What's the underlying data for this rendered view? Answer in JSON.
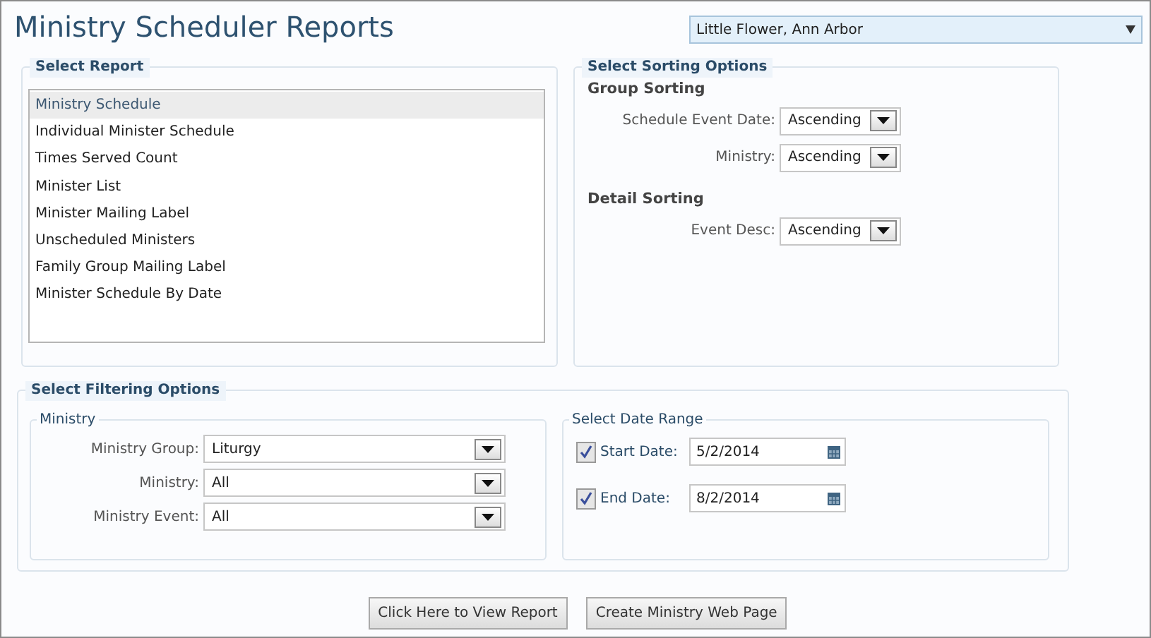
{
  "title": "Ministry Scheduler Reports",
  "parish_select": {
    "value": "Little Flower, Ann Arbor"
  },
  "report_panel": {
    "legend": "Select Report",
    "reports": [
      {
        "label": "Ministry Schedule",
        "selected": true
      },
      {
        "label": "Individual Minister Schedule",
        "selected": false
      },
      {
        "label": "Times Served Count",
        "selected": false
      },
      {
        "label": "Minister List",
        "selected": false
      },
      {
        "label": "Minister Mailing Label",
        "selected": false
      },
      {
        "label": "Unscheduled Ministers",
        "selected": false
      },
      {
        "label": "Family Group Mailing Label",
        "selected": false
      },
      {
        "label": "Minister Schedule By Date",
        "selected": false
      }
    ]
  },
  "sorting_panel": {
    "legend": "Select Sorting Options",
    "groups": [
      {
        "heading": "Group Sorting",
        "fields": [
          {
            "label": "Schedule Event Date:",
            "value": "Ascending"
          },
          {
            "label": "Ministry:",
            "value": "Ascending"
          }
        ]
      },
      {
        "heading": "Detail Sorting",
        "fields": [
          {
            "label": "Event Desc:",
            "value": "Ascending"
          }
        ]
      }
    ]
  },
  "filtering_panel": {
    "legend": "Select Filtering Options",
    "ministry": {
      "legend": "Ministry",
      "fields": [
        {
          "label": "Ministry Group:",
          "value": "Liturgy"
        },
        {
          "label": "Ministry:",
          "value": "All"
        },
        {
          "label": "Ministry Event:",
          "value": "All"
        }
      ]
    },
    "date_range": {
      "legend": "Select Date Range",
      "fields": [
        {
          "label": "Start Date:",
          "value": "5/2/2014",
          "checked": true
        },
        {
          "label": "End Date:",
          "value": "8/2/2014",
          "checked": true
        }
      ]
    }
  },
  "buttons": [
    "Click Here to View Report",
    "Create Ministry Web Page"
  ]
}
